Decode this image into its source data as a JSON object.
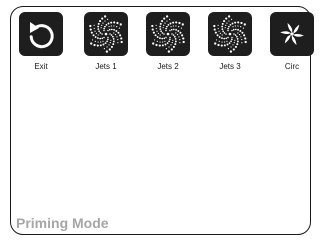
{
  "buttons": [
    {
      "label": "Exit",
      "icon": "back-arrow-icon"
    },
    {
      "label": "Jets 1",
      "icon": "jets-swirl-icon"
    },
    {
      "label": "Jets 2",
      "icon": "jets-swirl-icon"
    },
    {
      "label": "Jets 3",
      "icon": "jets-swirl-icon"
    },
    {
      "label": "Circ",
      "icon": "circulation-fan-icon"
    }
  ],
  "mode": {
    "label": "Priming Mode"
  },
  "colors": {
    "tile": "#1e1e1e",
    "icon": "#ffffff",
    "border": "#1a1a1a",
    "mode_text": "#a6a6a6"
  }
}
